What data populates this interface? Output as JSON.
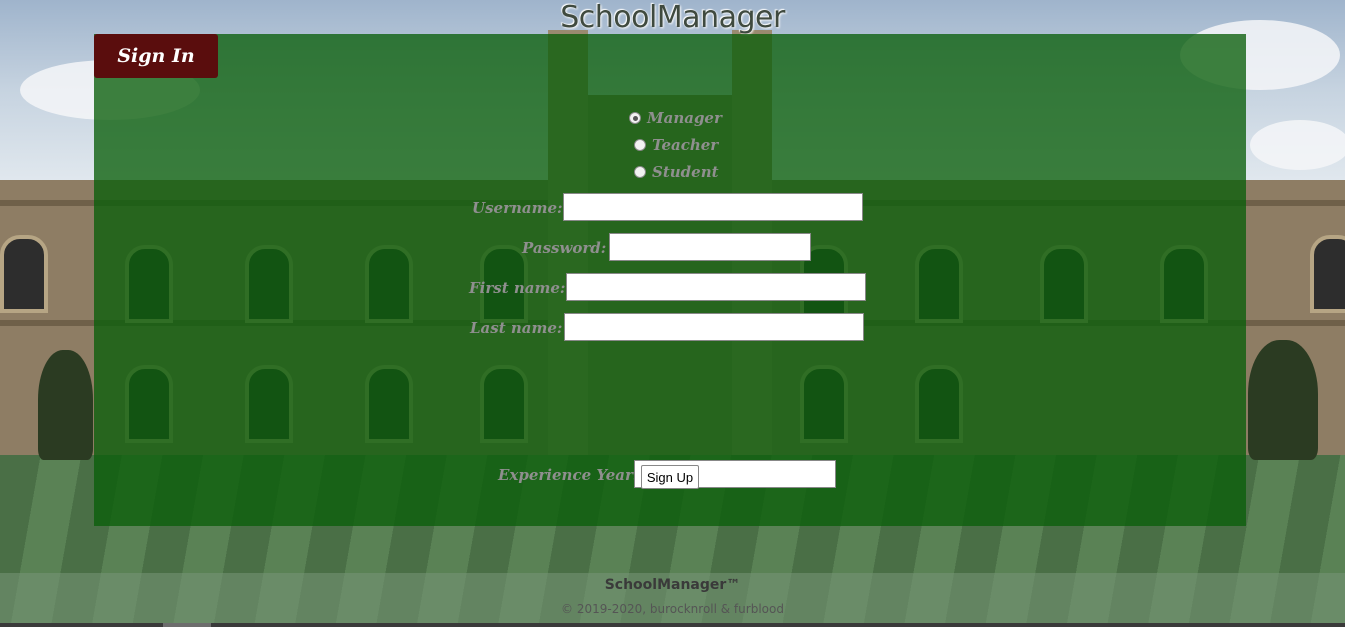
{
  "header": {
    "title": "SchoolManager"
  },
  "panel": {
    "signin_tab": "Sign In",
    "roles": [
      {
        "label": "Manager",
        "checked": true
      },
      {
        "label": "Teacher",
        "checked": false
      },
      {
        "label": "Student",
        "checked": false
      }
    ],
    "fields": {
      "username": {
        "label": "Username:",
        "value": ""
      },
      "password": {
        "label": "Password:",
        "value": ""
      },
      "firstname": {
        "label": "First name:",
        "value": ""
      },
      "lastname": {
        "label": "Last name:",
        "value": ""
      },
      "experience": {
        "label": "Experience Year:",
        "value": ""
      }
    },
    "signup_button": "Sign Up"
  },
  "footer": {
    "brand": "SchoolManager™",
    "copyright": "© 2019-2020, burocknroll & furblood"
  },
  "colors": {
    "panel_overlay": "#0a5f0a",
    "signin_tab": "#5a0d0d",
    "label_text": "#8f8f8f"
  }
}
